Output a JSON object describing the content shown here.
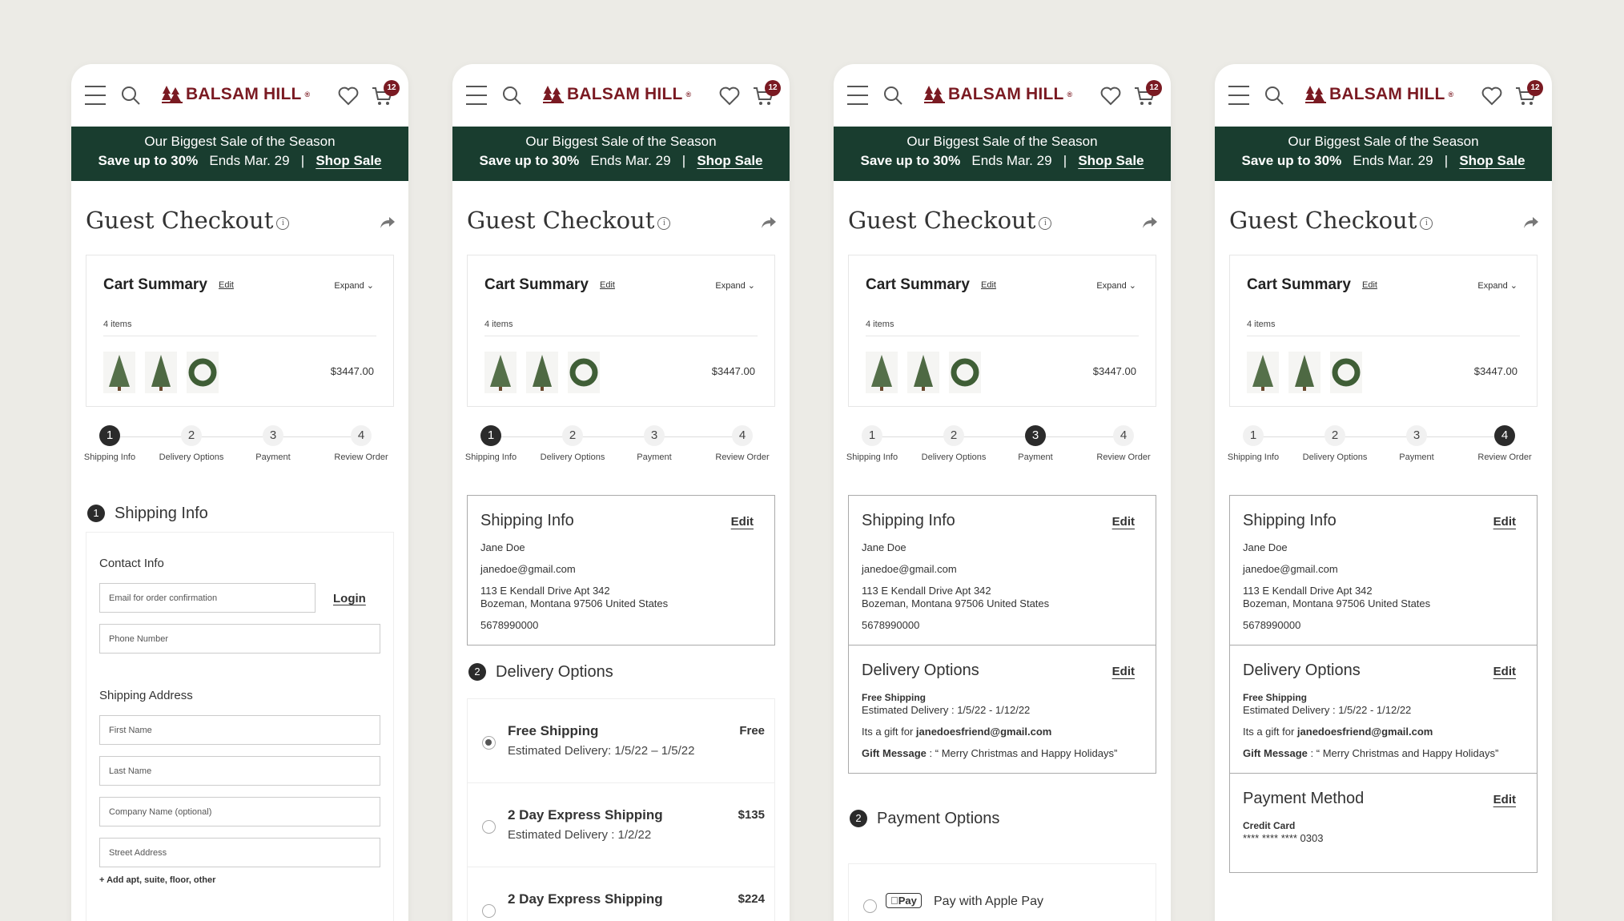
{
  "brand": {
    "name": "BALSAM HILL",
    "reg": "®",
    "accent": "#7a1a22",
    "promo_bg": "#193d2f"
  },
  "header": {
    "cart_count": "12",
    "icons": [
      "hamburger-icon",
      "search-icon",
      "heart-icon",
      "cart-icon"
    ]
  },
  "promo": {
    "line1": "Our Biggest Sale of the Season",
    "save": "Save up to 30%",
    "ends": "Ends Mar. 29",
    "sep": "|",
    "shop": "Shop Sale"
  },
  "page": {
    "title": "Guest Checkout",
    "info_glyph": "i"
  },
  "cart_summary": {
    "title": "Cart Summary",
    "edit": "Edit",
    "expand": "Expand",
    "count": "4 items",
    "price": "$3447.00"
  },
  "steps": [
    {
      "num": "1",
      "label": "Shipping Info"
    },
    {
      "num": "2",
      "label": "Delivery Options"
    },
    {
      "num": "3",
      "label": "Payment"
    },
    {
      "num": "4",
      "label": "Review Order"
    }
  ],
  "screen1": {
    "section_num": "1",
    "section_title": "Shipping Info",
    "contact_title": "Contact Info",
    "email_placeholder": "Email for order confirmation",
    "login": "Login",
    "phone_placeholder": "Phone Number",
    "address_title": "Shipping Address",
    "first_name": "First Name",
    "last_name": "Last Name",
    "company": "Company Name (optional)",
    "street": "Street Address",
    "add_apt": "Add apt, suite, floor, other"
  },
  "shipping_info": {
    "title": "Shipping Info",
    "edit": "Edit",
    "name": "Jane Doe",
    "email": "janedoe@gmail.com",
    "addr1": "113 E Kendall Drive Apt 342",
    "addr2": "Bozeman, Montana 97506 United States",
    "phone": "5678990000"
  },
  "screen2": {
    "section_num": "2",
    "section_title": "Delivery Options",
    "options": [
      {
        "name": "Free Shipping",
        "est": "Estimated Delivery: 1/5/22 – 1/5/22",
        "price": "Free"
      },
      {
        "name": "2 Day Express Shipping",
        "est": "Estimated Delivery : 1/2/22",
        "price": "$135"
      },
      {
        "name": "2 Day Express Shipping",
        "est": "",
        "price": "$224"
      }
    ]
  },
  "delivery_info": {
    "title": "Delivery Options",
    "edit": "Edit",
    "method": "Free Shipping",
    "est": "Estimated Delivery : 1/5/22 - 1/12/22",
    "gift_prefix": "Its a gift for ",
    "gift_email": "janedoesfriend@gmail.com",
    "msg_label": "Gift Message",
    "msg_text": " : “ Merry Christmas and Happy Holidays”"
  },
  "screen3": {
    "section_num": "2",
    "section_title": "Payment Options",
    "apple_badge": "Pay",
    "apple_label": "Pay with Apple Pay"
  },
  "payment_info": {
    "title": "Payment Method",
    "edit": "Edit",
    "method": "Credit Card",
    "masked": "**** **** **** 0303"
  }
}
